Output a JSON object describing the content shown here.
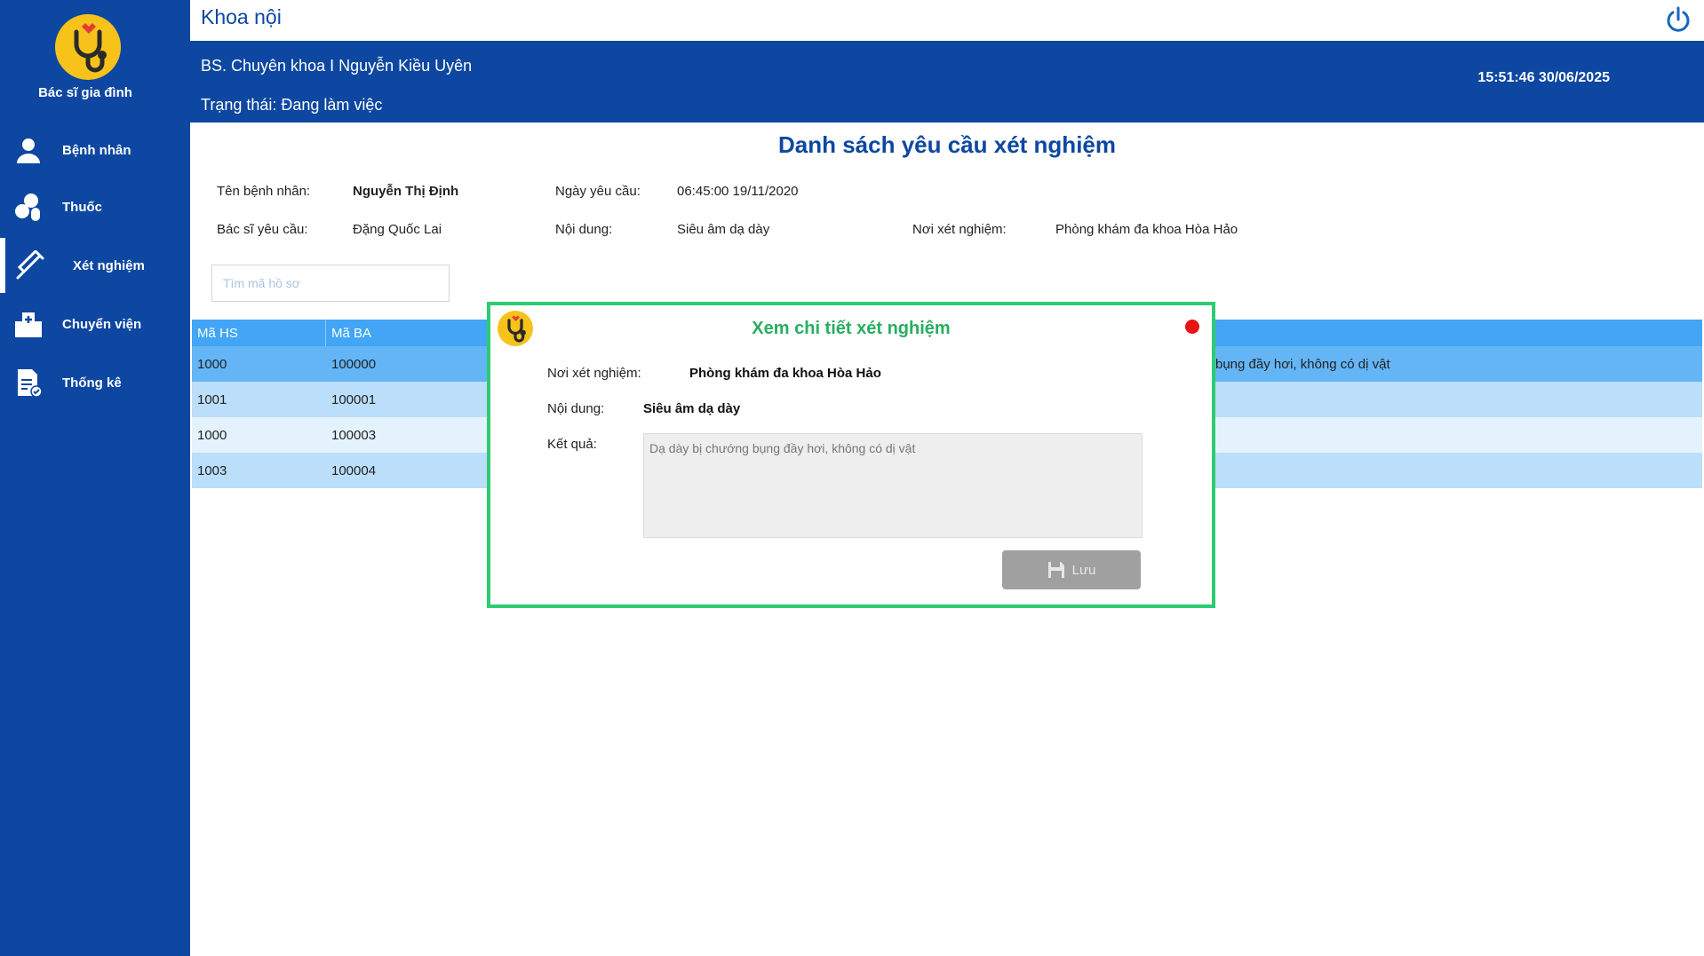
{
  "sidebar": {
    "app_name": "Bác sĩ gia đình",
    "items": [
      {
        "label": "Bệnh nhân",
        "icon": "user-icon"
      },
      {
        "label": "Thuốc",
        "icon": "pills-icon"
      },
      {
        "label": "Xét nghiệm",
        "icon": "syringe-icon",
        "active": true
      },
      {
        "label": "Chuyển viện",
        "icon": "hospital-icon"
      },
      {
        "label": "Thống kê",
        "icon": "report-icon"
      }
    ]
  },
  "header": {
    "department": "Khoa nội",
    "doctor": "BS. Chuyên khoa I Nguyễn Kiều Uyên",
    "status": "Trạng thái: Đang làm việc",
    "datetime": "15:51:46 30/06/2025"
  },
  "main": {
    "title": "Danh sách yêu cầu xét nghiệm",
    "info": {
      "patient_label": "Tên bệnh nhân:",
      "patient_value": "Nguyễn Thị Định",
      "request_date_label": "Ngày yêu cầu:",
      "request_date_value": "06:45:00 19/11/2020",
      "doctor_label": "Bác sĩ yêu cầu:",
      "doctor_value": "Đặng Quốc Lai",
      "content_label": "Nội dung:",
      "content_value": "Siêu âm dạ dày",
      "place_label": "Nơi xét nghiệm:",
      "place_value": "Phòng khám đa khoa Hòa Hảo"
    },
    "search": {
      "placeholder": "Tìm mã hồ sơ"
    },
    "table": {
      "headers": [
        "Mã HS",
        "Mã BA"
      ],
      "rows": [
        [
          "1000",
          "100000",
          "bụng đầy hơi, không có dị vật"
        ],
        [
          "1001",
          "100001",
          ""
        ],
        [
          "1000",
          "100003",
          ""
        ],
        [
          "1003",
          "100004",
          ""
        ]
      ]
    }
  },
  "modal": {
    "title": "Xem chi tiết xét nghiệm",
    "place_label": "Nơi xét nghiệm:",
    "place_value": "Phòng khám đa khoa Hòa Hảo",
    "content_label": "Nội dung:",
    "content_value": "Siêu âm dạ dày",
    "result_label": "Kết quả:",
    "result_value": "Dạ dày bị chướng bụng đầy hơi, không có dị vật",
    "save_label": "Lưu"
  },
  "colors": {
    "primary": "#0d47a1",
    "table_header": "#42a5f5",
    "modal_border": "#2ecc71",
    "modal_title": "#27ae60",
    "close_dot": "#e81313"
  }
}
